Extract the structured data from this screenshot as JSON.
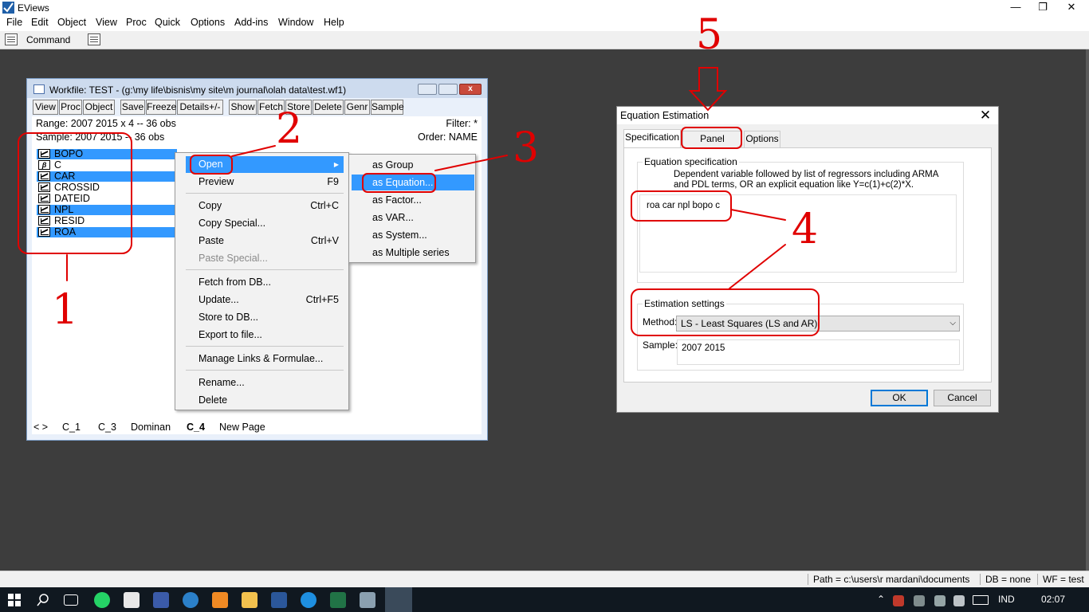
{
  "app": {
    "title": "EViews",
    "menu": [
      "File",
      "Edit",
      "Object",
      "View",
      "Proc",
      "Quick",
      "Options",
      "Add-ins",
      "Window",
      "Help"
    ],
    "command_label": "Command"
  },
  "workfile": {
    "title": "Workfile: TEST - (g:\\my life\\bisnis\\my site\\m journal\\olah data\\test.wf1)",
    "toolbar": [
      "View",
      "Proc",
      "Object",
      "Save",
      "Freeze",
      "Details+/-",
      "Show",
      "Fetch",
      "Store",
      "Delete",
      "Genr",
      "Sample"
    ],
    "range": "Range:  2007 2015 x 4   --   36 obs",
    "sample": "Sample: 2007 2015   --   36 obs",
    "filter": "Filter: *",
    "order": "Order: NAME",
    "objects": [
      {
        "name": "BOPO",
        "icon": "series-icon",
        "selected": true
      },
      {
        "name": "C",
        "icon": "coef-icon",
        "selected": false
      },
      {
        "name": "CAR",
        "icon": "series-icon",
        "selected": true
      },
      {
        "name": "CROSSID",
        "icon": "series-icon",
        "selected": false
      },
      {
        "name": "DATEID",
        "icon": "series-icon",
        "selected": false
      },
      {
        "name": "NPL",
        "icon": "series-icon",
        "selected": true
      },
      {
        "name": "RESID",
        "icon": "series-icon",
        "selected": false
      },
      {
        "name": "ROA",
        "icon": "series-icon",
        "selected": true
      }
    ],
    "coef_glyph": "β",
    "page_nav": "< >",
    "pages": [
      "C_1",
      "C_3",
      "Dominan",
      "C_4",
      "New Page"
    ],
    "active_page": "C_4"
  },
  "context_menu": {
    "items": [
      {
        "label": "Open",
        "shortcut": "",
        "submenu_arrow": "▶"
      },
      {
        "label": "Preview",
        "shortcut": "F9"
      },
      {
        "label": "Copy",
        "shortcut": "Ctrl+C"
      },
      {
        "label": "Copy Special...",
        "shortcut": ""
      },
      {
        "label": "Paste",
        "shortcut": "Ctrl+V"
      },
      {
        "label": "Paste Special...",
        "shortcut": ""
      },
      {
        "label": "Fetch from DB...",
        "shortcut": ""
      },
      {
        "label": "Update...",
        "shortcut": "Ctrl+F5"
      },
      {
        "label": "Store to DB...",
        "shortcut": ""
      },
      {
        "label": "Export to file...",
        "shortcut": ""
      },
      {
        "label": "Manage Links & Formulae...",
        "shortcut": ""
      },
      {
        "label": "Rename...",
        "shortcut": ""
      },
      {
        "label": "Delete",
        "shortcut": ""
      }
    ],
    "submenu": [
      "as Group",
      "as Equation...",
      "as Factor...",
      "as VAR...",
      "as System...",
      "as Multiple series"
    ]
  },
  "dialog": {
    "title": "Equation Estimation",
    "close": "✕",
    "tabs": [
      "Specification",
      "Panel Options",
      "Options"
    ],
    "spec_group": "Equation specification",
    "spec_desc_1": "Dependent variable followed by list of regressors including ARMA",
    "spec_desc_2": "and PDL terms, OR an explicit equation like Y=c(1)+c(2)*X.",
    "spec_value": "roa car npl bopo  c",
    "settings_group": "Estimation settings",
    "method_label": "Method:",
    "method_value": "LS  -  Least Squares (LS and AR)",
    "method_arrow": "⌵",
    "sample_label": "Sample:",
    "sample_value": "2007 2015",
    "ok": "OK",
    "cancel": "Cancel"
  },
  "statusbar": {
    "path": "Path = c:\\users\\r mardani\\documents",
    "db": "DB = none",
    "wf": "WF = test"
  },
  "taskbar": {
    "lang": "IND",
    "time": "02:07"
  },
  "annotations": {
    "numbers": [
      "1",
      "2",
      "3",
      "4",
      "5"
    ],
    "color": "#e00000"
  },
  "colors": {
    "selection": "#3399ff",
    "workspace": "#3d3d3d",
    "annotation": "#e00000"
  }
}
